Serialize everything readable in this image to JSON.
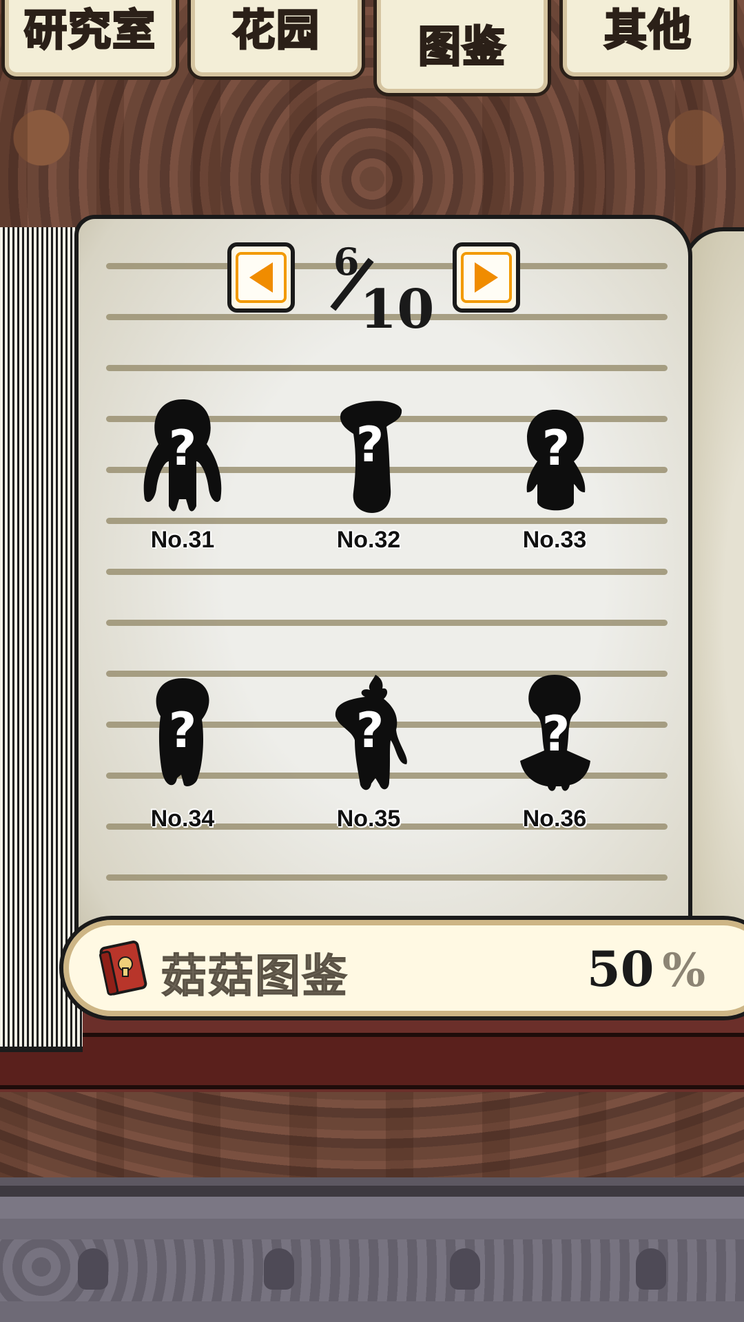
{
  "tabs": [
    {
      "label": "研究室",
      "active": false
    },
    {
      "label": "花园",
      "active": false
    },
    {
      "label": "图鉴",
      "active": true
    },
    {
      "label": "其他",
      "active": false
    }
  ],
  "pager": {
    "current": "6",
    "total": "10",
    "prev_icon": "left-arrow-icon",
    "next_icon": "right-arrow-icon"
  },
  "entries": [
    {
      "label": "No.31",
      "state": "locked"
    },
    {
      "label": "No.32",
      "state": "locked"
    },
    {
      "label": "No.33",
      "state": "locked"
    },
    {
      "label": "No.34",
      "state": "locked"
    },
    {
      "label": "No.35",
      "state": "locked"
    },
    {
      "label": "No.36",
      "state": "locked"
    }
  ],
  "progress": {
    "title": "菇菇图鉴",
    "value": "50",
    "unit": "%",
    "icon": "book-icon"
  },
  "colors": {
    "tab_active_text": "#ffd200",
    "arrow": "#f08c00",
    "page": "#eeeeea"
  }
}
